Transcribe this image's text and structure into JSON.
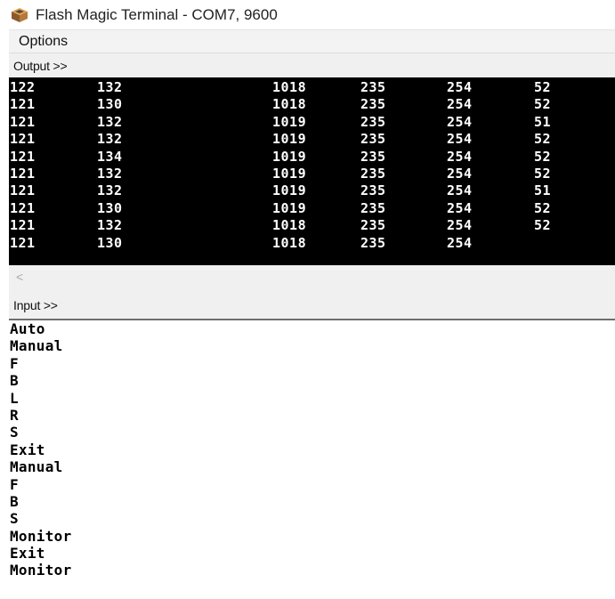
{
  "window": {
    "title": "Flash Magic Terminal - COM7, 9600",
    "icon": "flash-magic-icon"
  },
  "menu": {
    "items": [
      "Options"
    ]
  },
  "output": {
    "label": "Output >>",
    "rows": [
      [
        "122",
        "132",
        "1018",
        "235",
        "254",
        "52"
      ],
      [
        "121",
        "130",
        "1018",
        "235",
        "254",
        "52"
      ],
      [
        "121",
        "132",
        "1019",
        "235",
        "254",
        "51"
      ],
      [
        "121",
        "132",
        "1019",
        "235",
        "254",
        "52"
      ],
      [
        "121",
        "134",
        "1019",
        "235",
        "254",
        "52"
      ],
      [
        "121",
        "132",
        "1019",
        "235",
        "254",
        "52"
      ],
      [
        "121",
        "132",
        "1019",
        "235",
        "254",
        "51"
      ],
      [
        "121",
        "130",
        "1019",
        "235",
        "254",
        "52"
      ],
      [
        "121",
        "132",
        "1018",
        "235",
        "254",
        "52"
      ],
      [
        "121",
        "130",
        "1018",
        "235",
        "254",
        ""
      ]
    ]
  },
  "scrollbar": {
    "left_arrow": "<"
  },
  "input": {
    "label": "Input >>",
    "lines": [
      "Auto",
      "Manual",
      "F",
      "B",
      "L",
      "R",
      "S",
      "Exit",
      "Manual",
      "F",
      "B",
      "S",
      "Monitor",
      "Exit",
      "Monitor"
    ]
  }
}
